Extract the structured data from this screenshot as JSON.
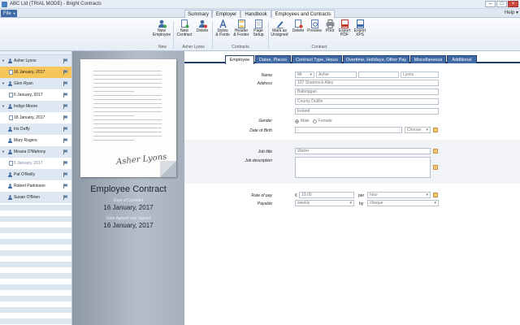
{
  "window": {
    "title": "ABC Ltd (TRIAL MODE) - Bright Contracts",
    "help_label": "Help"
  },
  "menu": {
    "file_label": "File",
    "tabs": [
      "Summary",
      "Employer",
      "Handbook",
      "Employees and Contracts"
    ]
  },
  "ribbon": {
    "buttons": [
      {
        "label1": "New",
        "label2": "Employee"
      },
      {
        "label1": "New",
        "label2": "Contract"
      },
      {
        "label1": "Delete",
        "label2": ""
      },
      {
        "label1": "Styles",
        "label2": "& Fonts"
      },
      {
        "label1": "Header",
        "label2": "& Footer"
      },
      {
        "label1": "Page",
        "label2": "Setup"
      },
      {
        "label1": "Mark as",
        "label2": "Unsigned"
      },
      {
        "label1": "Delete",
        "label2": ""
      },
      {
        "label1": "Preview",
        "label2": ""
      },
      {
        "label1": "Print",
        "label2": ""
      },
      {
        "label1": "Export",
        "label2": "PDF"
      },
      {
        "label1": "Export",
        "label2": "XPS"
      }
    ],
    "groups": [
      "New",
      "Asher Lyons",
      "Contracts",
      "Contract"
    ]
  },
  "tree": [
    {
      "type": "employee",
      "label": "Asher Lyons",
      "expanded": true
    },
    {
      "type": "contract",
      "label": "16 January, 2017",
      "selected": true
    },
    {
      "type": "employee",
      "label": "Glen Ryan",
      "expanded": true
    },
    {
      "type": "contract",
      "label": "6 January, 2017"
    },
    {
      "type": "employee",
      "label": "Indigo Moore",
      "expanded": true
    },
    {
      "type": "contract",
      "label": "18 January, 2017"
    },
    {
      "type": "employee",
      "label": "Iris Duffy"
    },
    {
      "type": "employee",
      "label": "Mary Rogers"
    },
    {
      "type": "employee",
      "label": "Moana O'Mahony",
      "expanded": true
    },
    {
      "type": "contract",
      "label": "5 January, 2017",
      "faded": true
    },
    {
      "type": "employee",
      "label": "Pat O'Reilly"
    },
    {
      "type": "employee",
      "label": "Robert Parkinson"
    },
    {
      "type": "employee",
      "label": "Susan O'Brien"
    }
  ],
  "preview": {
    "signature": "Asher Lyons",
    "title": "Employee Contract",
    "date_of_contract_label": "Date of Contract",
    "date_of_contract": "16 January, 2017",
    "date_signed_label": "Date Agreed and Signed",
    "date_signed": "16 January, 2017"
  },
  "content_tabs": [
    "Employee",
    "Dates, Places",
    "Contract Type, Hours",
    "Overtime, Holidays, Other Pay",
    "Miscellaneous",
    "Additional"
  ],
  "form": {
    "name_label": "Name",
    "title_value": "Mr",
    "first_name": "Asher",
    "middle_name": "",
    "last_name": "Lyons",
    "address_label": "Address",
    "address": [
      "107 Shamrock Alley",
      "Balbriggan",
      "County Dublin",
      "Ireland"
    ],
    "gender_label": "Gender",
    "gender_male": "Male",
    "gender_female": "Female",
    "dob_label": "Date of Birth",
    "dob_value": "",
    "choose_label": "Choose",
    "job_title_label": "Job title",
    "job_title_value": "Waiter",
    "job_desc_label": "Job description",
    "job_desc_value": "",
    "rate_label": "Rate of pay",
    "currency": "€",
    "rate_value": "10.00",
    "per_label": "per",
    "per_value": "hour",
    "payable_label": "Payable",
    "payable_value": "weekly",
    "by_label": "by",
    "by_value": "cheque"
  },
  "colors": {
    "accent_blue": "#3f6aa5",
    "selected_row": "#f6c65a",
    "tab_border": "#233e64"
  }
}
